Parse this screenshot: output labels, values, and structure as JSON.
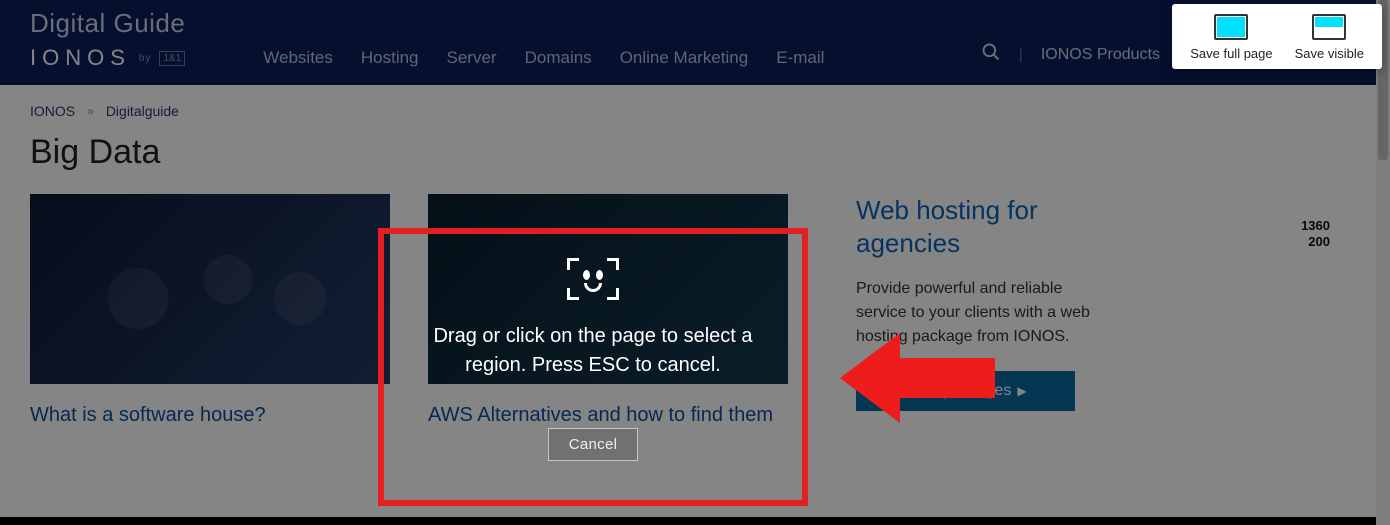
{
  "header": {
    "guide_title": "Digital Guide",
    "logo_text": "IONOS",
    "logo_sub": "by",
    "logo_badge": "1&1",
    "nav": [
      "Websites",
      "Hosting",
      "Server",
      "Domains",
      "Online Marketing",
      "E-mail"
    ],
    "divider": "|",
    "products_link": "IONOS Products"
  },
  "extension": {
    "full_label": "Save full page",
    "visible_label": "Save visible"
  },
  "breadcrumbs": {
    "root": "IONOS",
    "sep": "»",
    "current": "Digitalguide"
  },
  "page_title": "Big Data",
  "cards": [
    {
      "title": "What is a software house?"
    },
    {
      "title": "AWS Alternatives and how to find them"
    }
  ],
  "sidebar": {
    "heading": "Web hosting for agencies",
    "body": "Provide powerful and reliable service to your clients with a web hosting package from IONOS.",
    "cta": "View packages"
  },
  "ruler": {
    "w": "1360",
    "h": "200"
  },
  "capture": {
    "text": "Drag or click on the page to select a region. Press ESC to cancel.",
    "cancel": "Cancel"
  }
}
